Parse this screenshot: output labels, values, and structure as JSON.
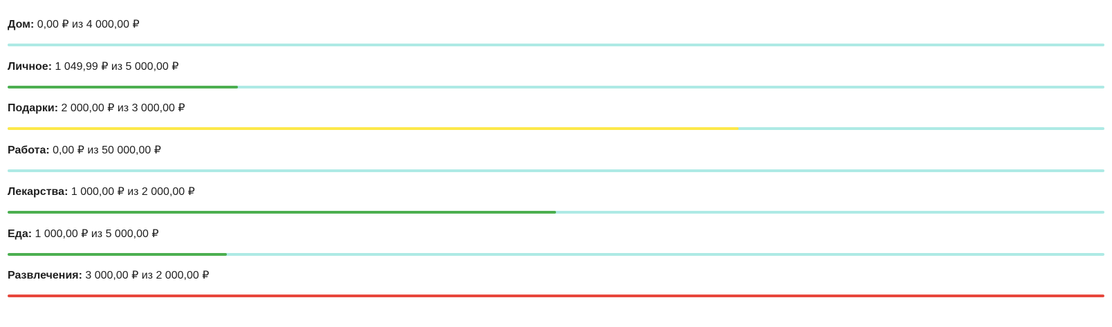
{
  "colors": {
    "track": "#aeeae5",
    "ok": "#4caf50",
    "warning": "#fde84a",
    "over": "#e8473c"
  },
  "categories": [
    {
      "name": "Дом",
      "amount": "0,00 ₽ из 4 000,00 ₽",
      "progress": 0.0,
      "status": "ok"
    },
    {
      "name": "Личное",
      "amount": "1 049,99 ₽ из 5 000,00 ₽",
      "progress": 0.21,
      "status": "ok"
    },
    {
      "name": "Подарки",
      "amount": "2 000,00 ₽ из 3 000,00 ₽",
      "progress": 0.6667,
      "status": "warning"
    },
    {
      "name": "Работа",
      "amount": "0,00 ₽ из 50 000,00 ₽",
      "progress": 0.0,
      "status": "ok"
    },
    {
      "name": "Лекарства",
      "amount": "1 000,00 ₽ из 2 000,00 ₽",
      "progress": 0.5,
      "status": "ok"
    },
    {
      "name": "Еда",
      "amount": "1 000,00 ₽ из 5 000,00 ₽",
      "progress": 0.2,
      "status": "ok"
    },
    {
      "name": "Развлечения",
      "amount": "3 000,00 ₽ из 2 000,00 ₽",
      "progress": 1.0,
      "status": "over"
    }
  ]
}
